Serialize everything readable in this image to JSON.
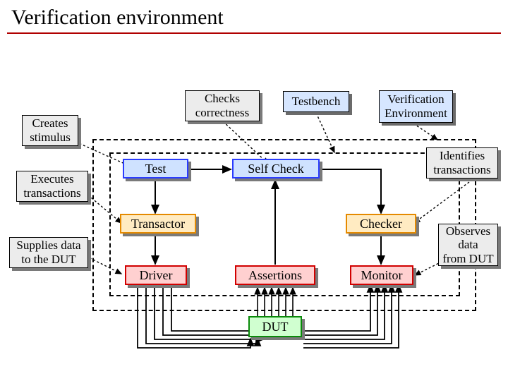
{
  "title": "Verification environment",
  "legends": {
    "creates": "Creates\nstimulus",
    "executes": "Executes\ntransactions",
    "supplies": "Supplies data\nto the DUT",
    "checks": "Checks\ncorrectness",
    "identifies": "Identifies\ntransactions",
    "observes": "Observes\ndata\nfrom DUT"
  },
  "env_labels": {
    "testbench": "Testbench",
    "verification_env": "Verification\nEnvironment"
  },
  "boxes": {
    "test": "Test",
    "selfcheck": "Self Check",
    "transactor": "Transactor",
    "checker": "Checker",
    "driver": "Driver",
    "assertions": "Assertions",
    "monitor": "Monitor",
    "dut": "DUT"
  }
}
